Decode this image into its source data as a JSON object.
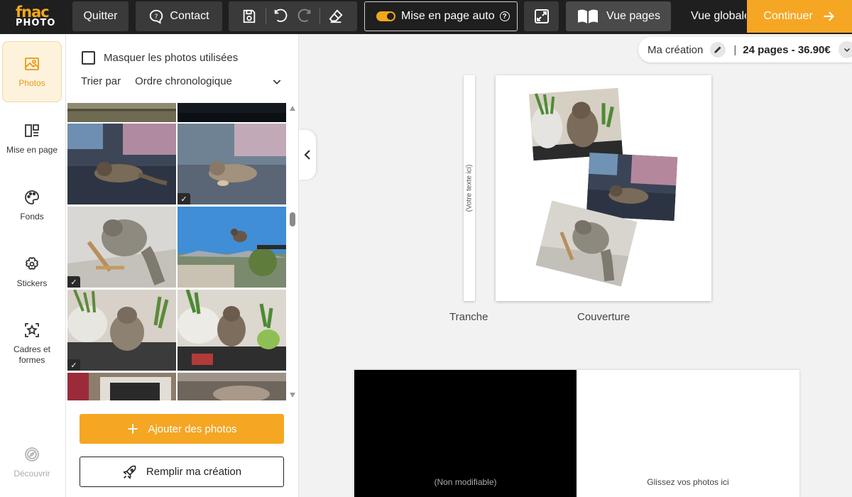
{
  "app": {
    "logo_top": "fnac",
    "logo_bottom": "PHOTO"
  },
  "toolbar": {
    "quit_label": "Quitter",
    "contact_label": "Contact",
    "auto_layout_label": "Mise en page auto",
    "vue_pages_label": "Vue pages",
    "vue_globale_label": "Vue globale",
    "continue_label": "Continuer"
  },
  "nav": {
    "items": [
      {
        "label": "Photos",
        "icon": "image-icon",
        "active": true
      },
      {
        "label": "Mise en page",
        "icon": "layout-icon"
      },
      {
        "label": "Fonds",
        "icon": "palette-icon"
      },
      {
        "label": "Stickers",
        "icon": "flower-icon"
      },
      {
        "label": "Cadres et formes",
        "icon": "frame-star-icon"
      }
    ],
    "discover_label": "Découvrir"
  },
  "panel": {
    "hide_used_label": "Masquer les photos utilisées",
    "hide_used_checked": false,
    "sort_label": "Trier par",
    "sort_value": "Ordre chronologique",
    "add_photos_label": "Ajouter des photos",
    "fill_label": "Remplir ma création"
  },
  "main": {
    "creation_name": "Ma création",
    "pages_price": "24 pages - 36.90€",
    "spine_placeholder": "(Votre texte ici)",
    "spine_caption": "Tranche",
    "cover_caption": "Couverture",
    "non_modifiable": "(Non modifiable)",
    "drop_hint": "Glissez vos photos ici"
  },
  "colors": {
    "accent": "#f5a623",
    "topbar": "#1f1f1f"
  }
}
